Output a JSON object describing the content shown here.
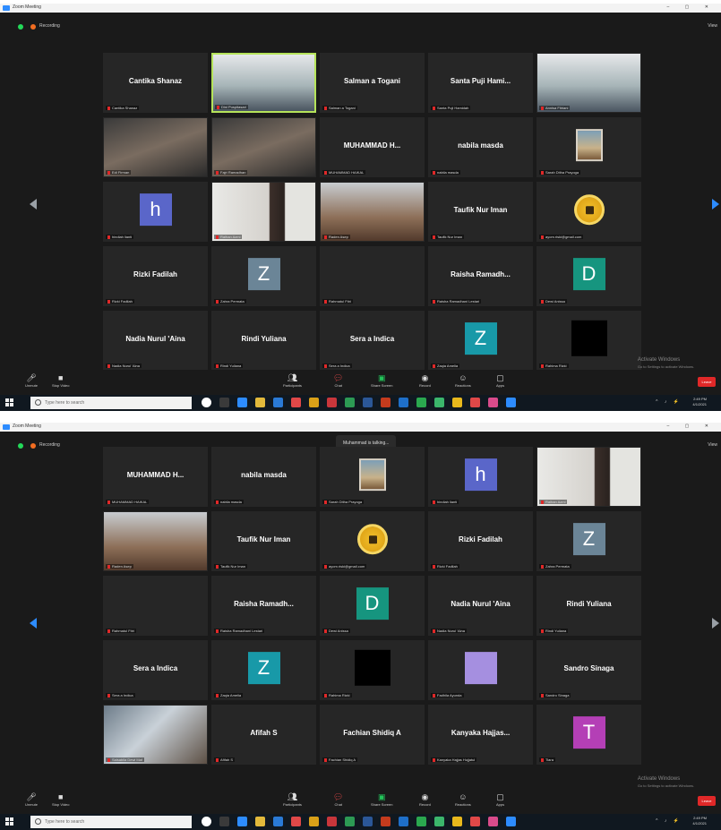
{
  "app": {
    "window_title": "Zoom Meeting",
    "recording_label": "Recording",
    "view_label": "View",
    "window_controls": "–  ▢  ✕"
  },
  "shot2_banner": "Muhammad is talking...",
  "shot1_tiles": [
    {
      "kind": "name",
      "name": "Cantika Shanaz",
      "caption": "Cantika Shanaz"
    },
    {
      "kind": "video",
      "video": "vid-hijab",
      "caption": "Dini Puspitasari",
      "active": true
    },
    {
      "kind": "name",
      "name": "Salman a Togani",
      "caption": "Salman a Togani"
    },
    {
      "kind": "name",
      "name": "Santa Puji Hami...",
      "caption": "Santa Puji Hamidah"
    },
    {
      "kind": "video",
      "video": "vid-hijab",
      "caption": "Annisa Fitriani"
    },
    {
      "kind": "video",
      "video": "vid-dark",
      "caption": "Edi Firman"
    },
    {
      "kind": "video",
      "video": "vid-dark",
      "caption": "Fajri Ramadhan"
    },
    {
      "kind": "name",
      "name": "MUHAMMAD H...",
      "caption": "MUHAMMAD HAIKAL"
    },
    {
      "kind": "name",
      "name": "nabila masda",
      "caption": "nabila masda"
    },
    {
      "kind": "picture",
      "caption": "Sarah Ditha Prayoga"
    },
    {
      "kind": "avatar",
      "letter": "h",
      "color": "#5a66c9",
      "caption": "hindiah lianti"
    },
    {
      "kind": "video",
      "video": "vid-face",
      "caption": "Raihan Azmi"
    },
    {
      "kind": "video",
      "video": "vid-room",
      "caption": "Raden Asep"
    },
    {
      "kind": "name",
      "name": "Taufik Nur Iman",
      "caption": "Taufik Nur Iman"
    },
    {
      "kind": "coin",
      "caption": "ayom.riski@gmail.com"
    },
    {
      "kind": "name",
      "name": "Rizki Fadilah",
      "caption": "Rizki Fadilah"
    },
    {
      "kind": "avatar",
      "letter": "Z",
      "color": "#6b8597",
      "caption": "Zahra Permata"
    },
    {
      "kind": "empty",
      "caption": "Rahmatul Fitri"
    },
    {
      "kind": "name",
      "name": "Raisha Ramadh...",
      "caption": "Raisha Ramadhani Lestari"
    },
    {
      "kind": "avatar",
      "letter": "D",
      "color": "#16957f",
      "caption": "Dewi Anissa"
    },
    {
      "kind": "name",
      "name": "Nadia Nurul 'Aina",
      "caption": "Nadia Nurul 'Aina"
    },
    {
      "kind": "name",
      "name": "Rindi Yuliana",
      "caption": "Rindi Yuliana"
    },
    {
      "kind": "name",
      "name": "Sera a Indica",
      "caption": "Sera a Indica"
    },
    {
      "kind": "avatar",
      "letter": "Z",
      "color": "#1899a8",
      "caption": "Zaqia Amelia"
    },
    {
      "kind": "black",
      "caption": "Rahima Rizki"
    }
  ],
  "shot2_tiles": [
    {
      "kind": "name",
      "name": "MUHAMMAD H...",
      "caption": "MUHAMMAD HAIKAL"
    },
    {
      "kind": "name",
      "name": "nabila masda",
      "caption": "nabila masda"
    },
    {
      "kind": "picture",
      "caption": "Sarah Ditha Prayoga"
    },
    {
      "kind": "avatar",
      "letter": "h",
      "color": "#5a66c9",
      "caption": "hindiah lianti"
    },
    {
      "kind": "video",
      "video": "vid-face",
      "caption": "Raihan Azmi"
    },
    {
      "kind": "video",
      "video": "vid-room",
      "caption": "Raden Asep"
    },
    {
      "kind": "name",
      "name": "Taufik Nur Iman",
      "caption": "Taufik Nur Iman"
    },
    {
      "kind": "coin",
      "caption": "ayom.riski@gmail.com"
    },
    {
      "kind": "name",
      "name": "Rizki Fadilah",
      "caption": "Rizki Fadilah"
    },
    {
      "kind": "avatar",
      "letter": "Z",
      "color": "#6b8597",
      "caption": "Zahra Permata"
    },
    {
      "kind": "empty",
      "caption": "Rahmatul Fitri"
    },
    {
      "kind": "name",
      "name": "Raisha Ramadh...",
      "caption": "Raisha Ramadhani Lestari"
    },
    {
      "kind": "avatar",
      "letter": "D",
      "color": "#16957f",
      "caption": "Dewi Anissa"
    },
    {
      "kind": "name",
      "name": "Nadia Nurul 'Aina",
      "caption": "Nadia Nurul 'Aina"
    },
    {
      "kind": "name",
      "name": "Rindi Yuliana",
      "caption": "Rindi Yuliana"
    },
    {
      "kind": "name",
      "name": "Sera a Indica",
      "caption": "Sera a Indica"
    },
    {
      "kind": "avatar",
      "letter": "Z",
      "color": "#1899a8",
      "caption": "Zaqia Amelia"
    },
    {
      "kind": "black",
      "caption": "Rahima Rizki"
    },
    {
      "kind": "avatar",
      "letter": "",
      "color": "#a58fe0",
      "caption": "Fadhila Ayunda"
    },
    {
      "kind": "name",
      "name": "Sandro Sinaga",
      "caption": "Sandro Sinaga"
    },
    {
      "kind": "video",
      "video": "vid-indoor",
      "caption": "Salsabila Dewi Maf"
    },
    {
      "kind": "name",
      "name": "Afifah S",
      "caption": "Afifah S"
    },
    {
      "kind": "name",
      "name": "Fachian Shidiq A",
      "caption": "Fachian Shidiq A"
    },
    {
      "kind": "name",
      "name": "Kanyaka Hajjas...",
      "caption": "Kanyaka Hajjas Hujjatul"
    },
    {
      "kind": "avatar",
      "letter": "T",
      "color": "#b43fb6",
      "caption": "Tiara"
    }
  ],
  "toolbar": {
    "mute": "Unmute",
    "video": "Stop Video",
    "participants": "Participants",
    "participants_count": "31",
    "chat": "Chat",
    "share": "Share Screen",
    "record": "Record",
    "reactions": "Reactions",
    "apps": "Apps",
    "end": "Leave"
  },
  "watermark": {
    "line1": "Activate Windows",
    "line2": "Go to Settings to activate Windows."
  },
  "taskbar": {
    "search_placeholder": "Type here to search",
    "time": "2:49 PM",
    "date": "4/1/2021"
  }
}
